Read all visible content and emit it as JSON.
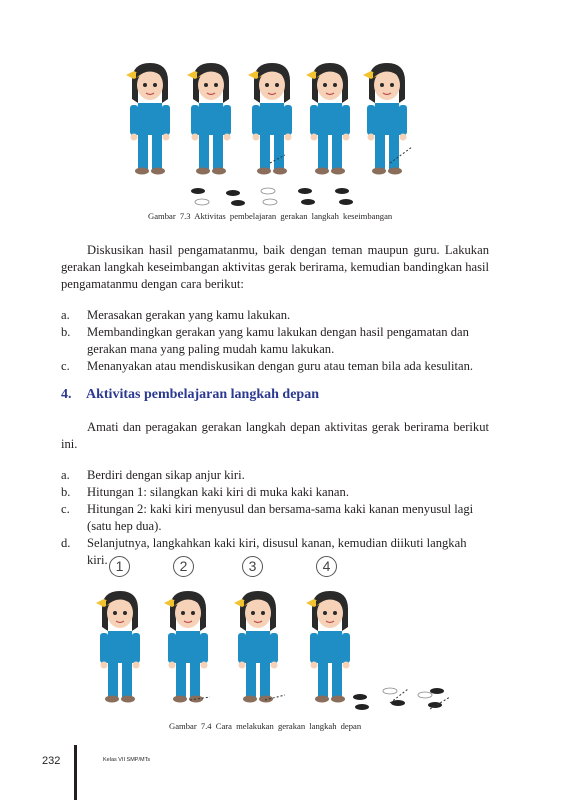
{
  "figure_top": {
    "caption": "Gambar 7.3 Aktivitas pembelajaran gerakan langkah keseimbangan"
  },
  "section_a": {
    "paragraph": "Diskusikan hasil pengamatanmu, baik dengan teman maupun guru. Lakukan gerakan langkah keseimbangan aktivitas gerak berirama, kemudian bandingkan hasil pengamatanmu dengan cara berikut:",
    "items": [
      {
        "marker": "a.",
        "text": "Merasakan gerakan yang kamu lakukan."
      },
      {
        "marker": "b.",
        "text": "Membandingkan gerakan yang kamu lakukan dengan hasil pengamatan dan gerakan mana yang paling mudah kamu lakukan."
      },
      {
        "marker": "c.",
        "text": "Menanyakan atau mendiskusikan dengan guru atau teman bila ada kesulitan."
      }
    ]
  },
  "heading": {
    "number": "4.",
    "title": "Aktivitas pembelajaran langkah depan"
  },
  "section_b": {
    "paragraph": "Amati dan peragakan gerakan langkah depan aktivitas gerak berirama berikut ini.",
    "items": [
      {
        "marker": "a.",
        "text": "Berdiri dengan sikap anjur kiri."
      },
      {
        "marker": "b.",
        "text": "Hitungan 1: silangkan kaki kiri di muka kaki kanan."
      },
      {
        "marker": "c.",
        "text": "Hitungan 2: kaki kiri menyusul dan bersama-sama kaki kanan menyusul lagi (satu hep dua)."
      },
      {
        "marker": "d.",
        "text": "Selanjutnya, langkahkan kaki kiri, disusul kanan, kemudian diikuti langkah kiri."
      }
    ]
  },
  "figure_bottom": {
    "steps": [
      "1",
      "2",
      "3",
      "4"
    ],
    "caption": "Gambar 7.4 Cara melakukan gerakan langkah depan"
  },
  "footer": {
    "page_number": "232",
    "book_title": "Kelas VII SMP/MTs"
  },
  "colors": {
    "heading": "#2b3990",
    "uniform": "#1f8ec5",
    "hair": "#2a2a2a",
    "skin": "#f6d2b8",
    "ribbon": "#f2c230"
  }
}
